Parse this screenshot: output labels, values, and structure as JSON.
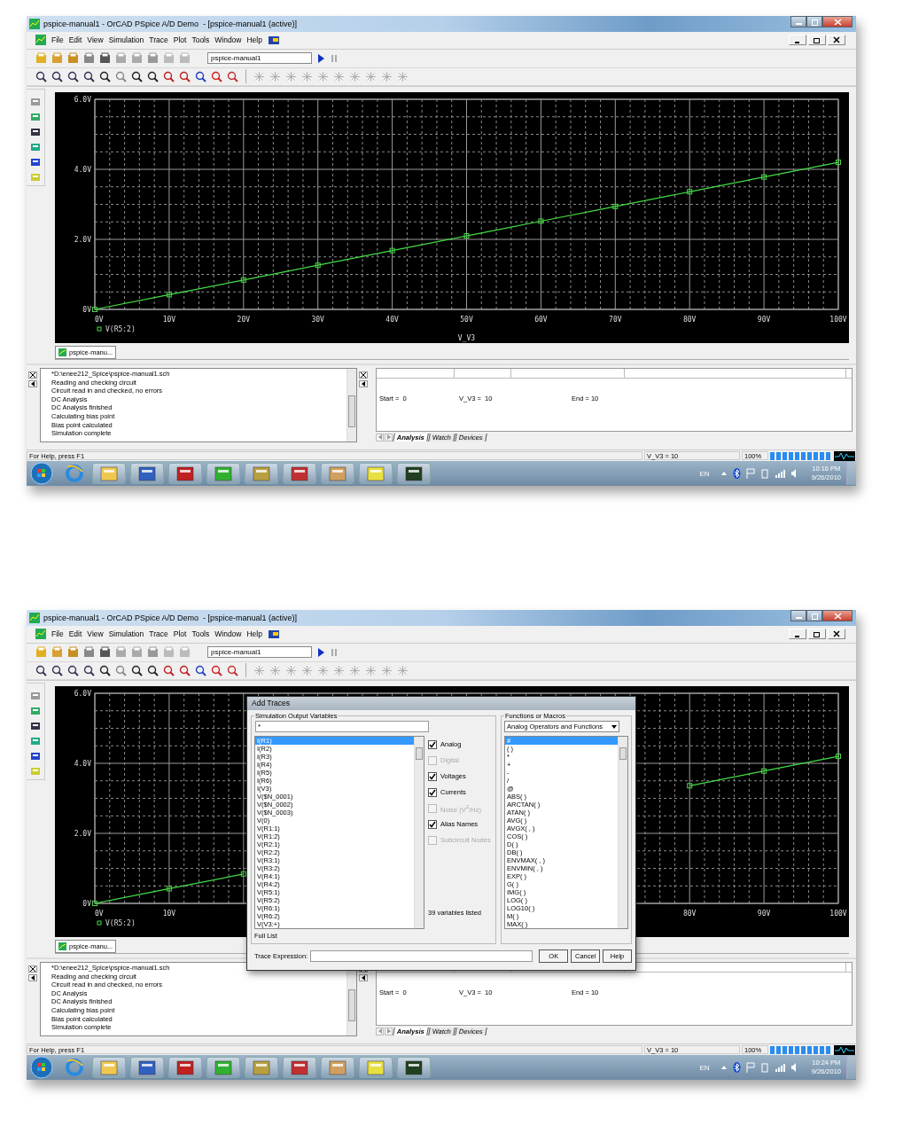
{
  "screenshots": [
    {
      "window": {
        "title": "pspice-manual1 - OrCAD PSpice A/D Demo  - [pspice-manual1 (active)]"
      },
      "menu": [
        "File",
        "Edit",
        "View",
        "Simulation",
        "Trace",
        "Plot",
        "Tools",
        "Window",
        "Help"
      ],
      "profile_field": {
        "value": "pspice-manual1"
      },
      "plot": {
        "tab": "pspice-manu...",
        "chart_data": {
          "type": "line",
          "xlabel": "V_V3",
          "x": [
            0,
            10,
            20,
            30,
            40,
            50,
            60,
            70,
            80,
            90,
            100
          ],
          "series": [
            {
              "name": "V(R5:2)",
              "color": "#44dd44",
              "marker": "square",
              "values": [
                0,
                0.42,
                0.84,
                1.26,
                1.68,
                2.1,
                2.52,
                2.94,
                3.36,
                3.78,
                4.2
              ]
            }
          ],
          "xlim": [
            0,
            100
          ],
          "ylim": [
            0,
            6
          ],
          "grid": true,
          "xticks": [
            {
              "value": 0,
              "label": "0V"
            },
            {
              "value": 10,
              "label": "10V"
            },
            {
              "value": 20,
              "label": "20V"
            },
            {
              "value": 30,
              "label": "30V"
            },
            {
              "value": 40,
              "label": "40V"
            },
            {
              "value": 50,
              "label": "50V"
            },
            {
              "value": 60,
              "label": "60V"
            },
            {
              "value": 70,
              "label": "70V"
            },
            {
              "value": 80,
              "label": "80V"
            },
            {
              "value": 90,
              "label": "90V"
            },
            {
              "value": 100,
              "label": "100V"
            }
          ],
          "yticks": [
            {
              "value": 0,
              "label": "0V"
            },
            {
              "value": 2,
              "label": "2.0V"
            },
            {
              "value": 4,
              "label": "4.0V"
            },
            {
              "value": 6,
              "label": "6.0V"
            }
          ]
        }
      },
      "output_log": [
        "*D:\\enee212_Spice\\pspice-manual1.sch",
        "Reading and checking circuit",
        "Circuit read in and checked, no errors",
        "DC Analysis",
        "DC Analysis finished",
        "Calculating bias point",
        "Bias point calculated",
        "Simulation complete"
      ],
      "analysis": {
        "fields": [
          "Start =  0",
          "V_V3 =  10",
          "End = 10"
        ],
        "tabs": [
          {
            "label": "Analysis",
            "selected": true
          },
          {
            "label": "Watch",
            "selected": false
          },
          {
            "label": "Devices",
            "selected": false
          }
        ]
      },
      "status_bar": {
        "help": "For Help, press F1",
        "sweep": "V_V3 = 10",
        "zoom": "100%",
        "level": 1
      },
      "taskbar": {
        "language": "EN",
        "time": "10:16 PM",
        "date": "9/26/2010"
      }
    },
    {
      "window": {
        "title": "pspice-manual1 - OrCAD PSpice A/D Demo  - [pspice-manual1 (active)]"
      },
      "menu": [
        "File",
        "Edit",
        "View",
        "Simulation",
        "Trace",
        "Plot",
        "Tools",
        "Window",
        "Help"
      ],
      "profile_field": {
        "value": "pspice-manual1"
      },
      "plot": {
        "tab": "pspice-manu...",
        "chart_data": {
          "type": "line",
          "x": [
            0,
            10,
            20,
            30,
            40,
            50,
            60,
            70,
            80,
            90,
            100
          ],
          "series": [
            {
              "name": "V(R5:2)",
              "color": "#44dd44",
              "marker": "square",
              "values": [
                0,
                0.42,
                0.84,
                null,
                null,
                null,
                null,
                null,
                3.36,
                3.78,
                4.2
              ]
            }
          ],
          "xlim": [
            0,
            100
          ],
          "ylim": [
            0,
            6
          ],
          "grid": true,
          "xticks": [
            {
              "value": 0,
              "label": "0V"
            },
            {
              "value": 10,
              "label": "10V"
            },
            {
              "value": 80,
              "label": "80V"
            },
            {
              "value": 90,
              "label": "90V"
            },
            {
              "value": 100,
              "label": "100V"
            }
          ],
          "yticks": [
            {
              "value": 0,
              "label": "0V"
            },
            {
              "value": 2,
              "label": "2.0V"
            },
            {
              "value": 4,
              "label": "4.0V"
            },
            {
              "value": 6,
              "label": "6.0V"
            }
          ]
        }
      },
      "output_log": [
        "*D:\\enee212_Spice\\pspice-manual1.sch",
        "Reading and checking circuit",
        "Circuit read in and checked, no errors",
        "DC Analysis",
        "DC Analysis finished",
        "Calculating bias point",
        "Bias point calculated",
        "Simulation complete"
      ],
      "analysis": {
        "fields": [
          "Start =  0",
          "V_V3 =  10",
          "End = 10"
        ],
        "tabs": [
          {
            "label": "Analysis",
            "selected": true
          },
          {
            "label": "Watch",
            "selected": false
          },
          {
            "label": "Devices",
            "selected": false
          }
        ]
      },
      "status_bar": {
        "help": "For Help, press F1",
        "sweep": "V_V3 = 10",
        "zoom": "100%",
        "level": 1
      },
      "taskbar": {
        "language": "EN",
        "time": "10:24 PM",
        "date": "9/26/2010"
      },
      "dialog": {
        "title": "Add Traces",
        "variables_group": "Simulation Output Variables",
        "filter": "*",
        "variables": [
          {
            "label": "I(R1)",
            "selected": true
          },
          {
            "label": "I(R2)",
            "selected": false
          },
          {
            "label": "I(R3)",
            "selected": false
          },
          {
            "label": "I(R4)",
            "selected": false
          },
          {
            "label": "I(R5)",
            "selected": false
          },
          {
            "label": "I(R6)",
            "selected": false
          },
          {
            "label": "I(V3)",
            "selected": false
          },
          {
            "label": "V($N_0001)",
            "selected": false
          },
          {
            "label": "V($N_0002)",
            "selected": false
          },
          {
            "label": "V($N_0003)",
            "selected": false
          },
          {
            "label": "V(0)",
            "selected": false
          },
          {
            "label": "V(R1:1)",
            "selected": false
          },
          {
            "label": "V(R1:2)",
            "selected": false
          },
          {
            "label": "V(R2:1)",
            "selected": false
          },
          {
            "label": "V(R2:2)",
            "selected": false
          },
          {
            "label": "V(R3:1)",
            "selected": false
          },
          {
            "label": "V(R3:2)",
            "selected": false
          },
          {
            "label": "V(R4:1)",
            "selected": false
          },
          {
            "label": "V(R4:2)",
            "selected": false
          },
          {
            "label": "V(R5:1)",
            "selected": false
          },
          {
            "label": "V(R5:2)",
            "selected": false
          },
          {
            "label": "V(R6:1)",
            "selected": false
          },
          {
            "label": "V(R6:2)",
            "selected": false
          },
          {
            "label": "V(V3:+)",
            "selected": false
          }
        ],
        "options": [
          {
            "label": "Analog",
            "checked": true,
            "disabled": false
          },
          {
            "label": "Digital",
            "checked": false,
            "disabled": true
          },
          {
            "label": "Voltages",
            "checked": true,
            "disabled": false
          },
          {
            "label": "Currents",
            "checked": true,
            "disabled": false
          },
          {
            "label": "Noise (V$^{2}$/Hz)",
            "checked": false,
            "disabled": true
          },
          {
            "label": "Alias Names",
            "checked": true,
            "disabled": false
          },
          {
            "label": "Subcircuit Nodes",
            "checked": false,
            "disabled": true
          }
        ],
        "count": "39 variables listed",
        "list_mode": "Full List",
        "functions_group": "Functions or Macros",
        "functions_dropdown": "Analog Operators and Functions",
        "functions": [
          {
            "label": "#",
            "selected": true
          },
          {
            "label": "( )",
            "selected": false
          },
          {
            "label": "*",
            "selected": false
          },
          {
            "label": "+",
            "selected": false
          },
          {
            "label": "-",
            "selected": false
          },
          {
            "label": "/",
            "selected": false
          },
          {
            "label": "@",
            "selected": false
          },
          {
            "label": "ABS( )",
            "selected": false
          },
          {
            "label": "ARCTAN( )",
            "selected": false
          },
          {
            "label": "ATAN( )",
            "selected": false
          },
          {
            "label": "AVG( )",
            "selected": false
          },
          {
            "label": "AVGX( , )",
            "selected": false
          },
          {
            "label": "COS( )",
            "selected": false
          },
          {
            "label": "D( )",
            "selected": false
          },
          {
            "label": "DB( )",
            "selected": false
          },
          {
            "label": "ENVMAX( , )",
            "selected": false
          },
          {
            "label": "ENVMIN( , )",
            "selected": false
          },
          {
            "label": "EXP( )",
            "selected": false
          },
          {
            "label": "G( )",
            "selected": false
          },
          {
            "label": "IMG( )",
            "selected": false
          },
          {
            "label": "LOG( )",
            "selected": false
          },
          {
            "label": "LOG10( )",
            "selected": false
          },
          {
            "label": "M( )",
            "selected": false
          },
          {
            "label": "MAX( )",
            "selected": false
          }
        ],
        "expression_label": "Trace Expression:",
        "buttons": [
          "OK",
          "Cancel",
          "Help"
        ]
      }
    }
  ]
}
